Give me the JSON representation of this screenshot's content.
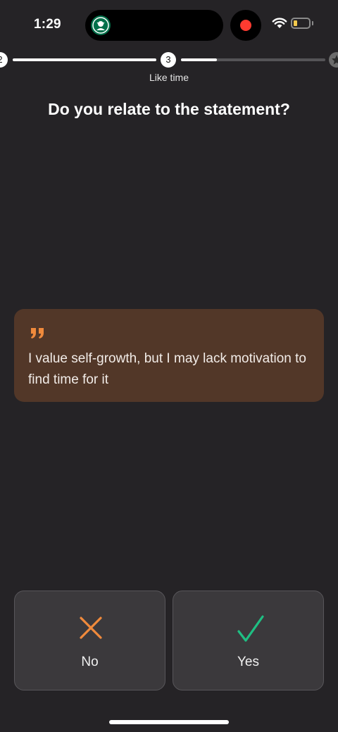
{
  "status_bar": {
    "time": "1:29",
    "colors": {
      "recording": "#ff3b30",
      "starbucks": "#00704A",
      "battery_fill": "#f2c94c"
    },
    "icons": [
      "starbucks-logo",
      "recording-dot",
      "wifi-icon",
      "battery-icon"
    ]
  },
  "progress": {
    "previous_step": "2",
    "current_step": "3",
    "current_label": "Like time",
    "current_segment_progress": 0.25,
    "final_icon": "star-icon"
  },
  "question": "Do you relate to the statement?",
  "quote": {
    "icon": "quote-icon",
    "text": "I value self-growth, but I may lack motivation to find time for it",
    "background": "#523728",
    "accent": "#f08a3c"
  },
  "answers": {
    "no": {
      "label": "No",
      "icon": "x-icon",
      "color": "#f08a3c"
    },
    "yes": {
      "label": "Yes",
      "icon": "check-icon",
      "color": "#1fbf83"
    }
  }
}
